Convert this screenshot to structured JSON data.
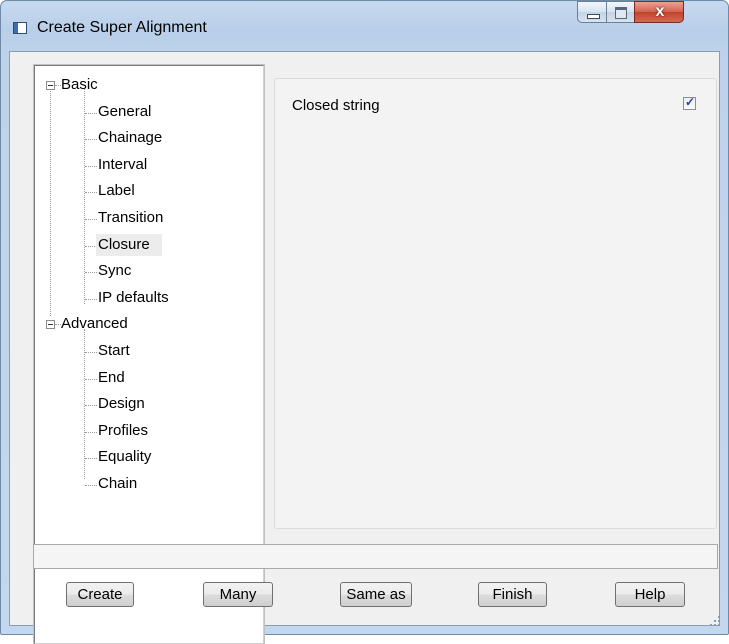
{
  "window": {
    "title": "Create Super Alignment"
  },
  "tree": {
    "nodes": [
      {
        "label": "Basic",
        "level": 0,
        "expanded": true
      },
      {
        "label": "General",
        "level": 1
      },
      {
        "label": "Chainage",
        "level": 1
      },
      {
        "label": "Interval",
        "level": 1
      },
      {
        "label": "Label",
        "level": 1
      },
      {
        "label": "Transition",
        "level": 1
      },
      {
        "label": "Closure",
        "level": 1,
        "selected": true
      },
      {
        "label": "Sync",
        "level": 1
      },
      {
        "label": "IP defaults",
        "level": 1
      },
      {
        "label": "Advanced",
        "level": 0,
        "expanded": true
      },
      {
        "label": "Start",
        "level": 1
      },
      {
        "label": "End",
        "level": 1
      },
      {
        "label": "Design",
        "level": 1
      },
      {
        "label": "Profiles",
        "level": 1
      },
      {
        "label": "Equality",
        "level": 1
      },
      {
        "label": "Chain",
        "level": 1
      }
    ]
  },
  "panel": {
    "closed_string_label": "Closed string",
    "closed_string_checked": true
  },
  "status_text": "",
  "buttons": {
    "create": "Create",
    "many": "Many",
    "same_as": "Same as",
    "finish": "Finish",
    "help": "Help"
  },
  "colors": {
    "titlebar": "#c7d9ef",
    "close_button": "#c2442c",
    "selected_item_bg": "#ececec"
  }
}
